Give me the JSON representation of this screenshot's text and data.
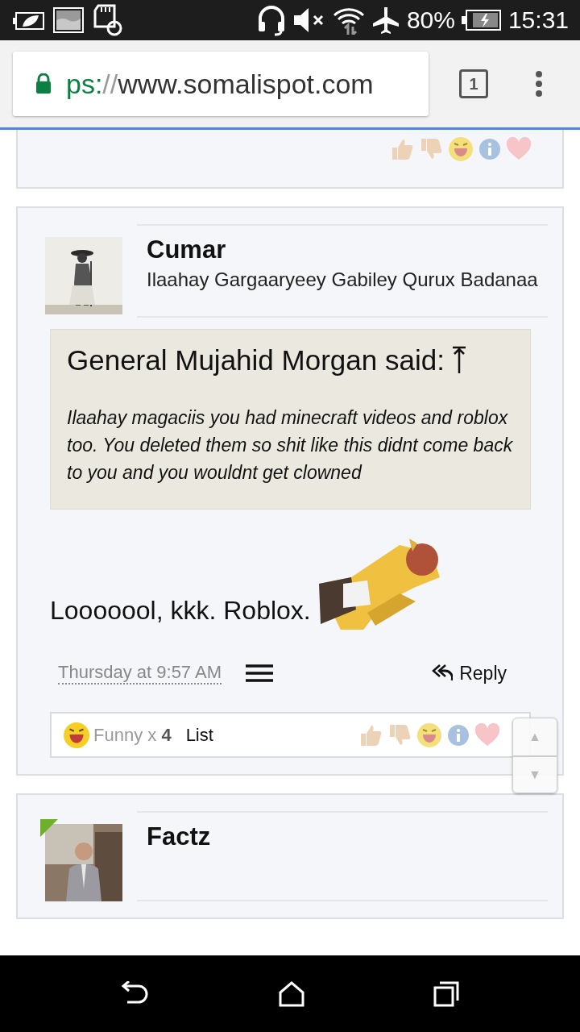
{
  "status_bar": {
    "battery": "80%",
    "time": "15:31"
  },
  "browser": {
    "url": {
      "scheme": "ps:",
      "separator": "//",
      "host": "www.somalispot.com"
    },
    "tab_count": "1"
  },
  "posts": [
    {
      "kind": "tail"
    },
    {
      "kind": "full",
      "author": "Cumar",
      "user_title": "Ilaahay Gargaaryeey Gabiley Qurux Badanaa",
      "quote": {
        "attribution": "General Mujahid Morgan said:",
        "text": "Ilaahay magaciis you had minecraft videos and roblox too. You deleted them so shit like this didnt come back to you and you wouldnt get clowned"
      },
      "message": "Looooool, kkk. Roblox.",
      "date": "Thursday at 9:57 AM",
      "reply": "Reply",
      "reaction_summary": "Funny x **4**",
      "list_link": "List"
    },
    {
      "kind": "head",
      "author": "Factz",
      "online": true
    }
  ],
  "scroll_buttons": [
    "▲",
    "▼"
  ]
}
